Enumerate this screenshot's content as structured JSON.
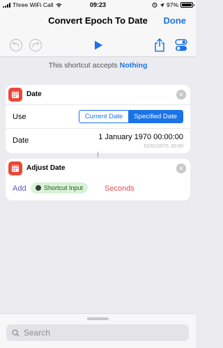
{
  "status_bar": {
    "carrier": "Three WiFi Call",
    "time": "09:23",
    "battery": "97%",
    "battery_level": 0.97
  },
  "nav": {
    "title": "Convert Epoch To Date",
    "done_label": "Done"
  },
  "toolbar": {
    "icons": [
      "undo-icon",
      "redo-icon",
      "play-icon",
      "share-icon",
      "settings-toggle-icon"
    ]
  },
  "accepts": {
    "prefix": "This shortcut accepts",
    "value": "Nothing"
  },
  "date_action": {
    "title": "Date",
    "use_label": "Use",
    "options": [
      "Current Date",
      "Specified Date"
    ],
    "selected": "Specified Date",
    "date_label": "Date",
    "date_value": "1 January  1970 00:00:00",
    "date_hint": "01/01/1970, 00:00"
  },
  "adjust_action": {
    "title": "Adjust Date",
    "add_label": "Add",
    "variable": "Shortcut Input",
    "unit": "Seconds"
  },
  "search": {
    "placeholder": "Search"
  },
  "colors": {
    "accent": "#1a73e8",
    "action_red": "#e9493a",
    "chip_green": "#d9f3d9",
    "unit_red": "#e34b4b"
  }
}
